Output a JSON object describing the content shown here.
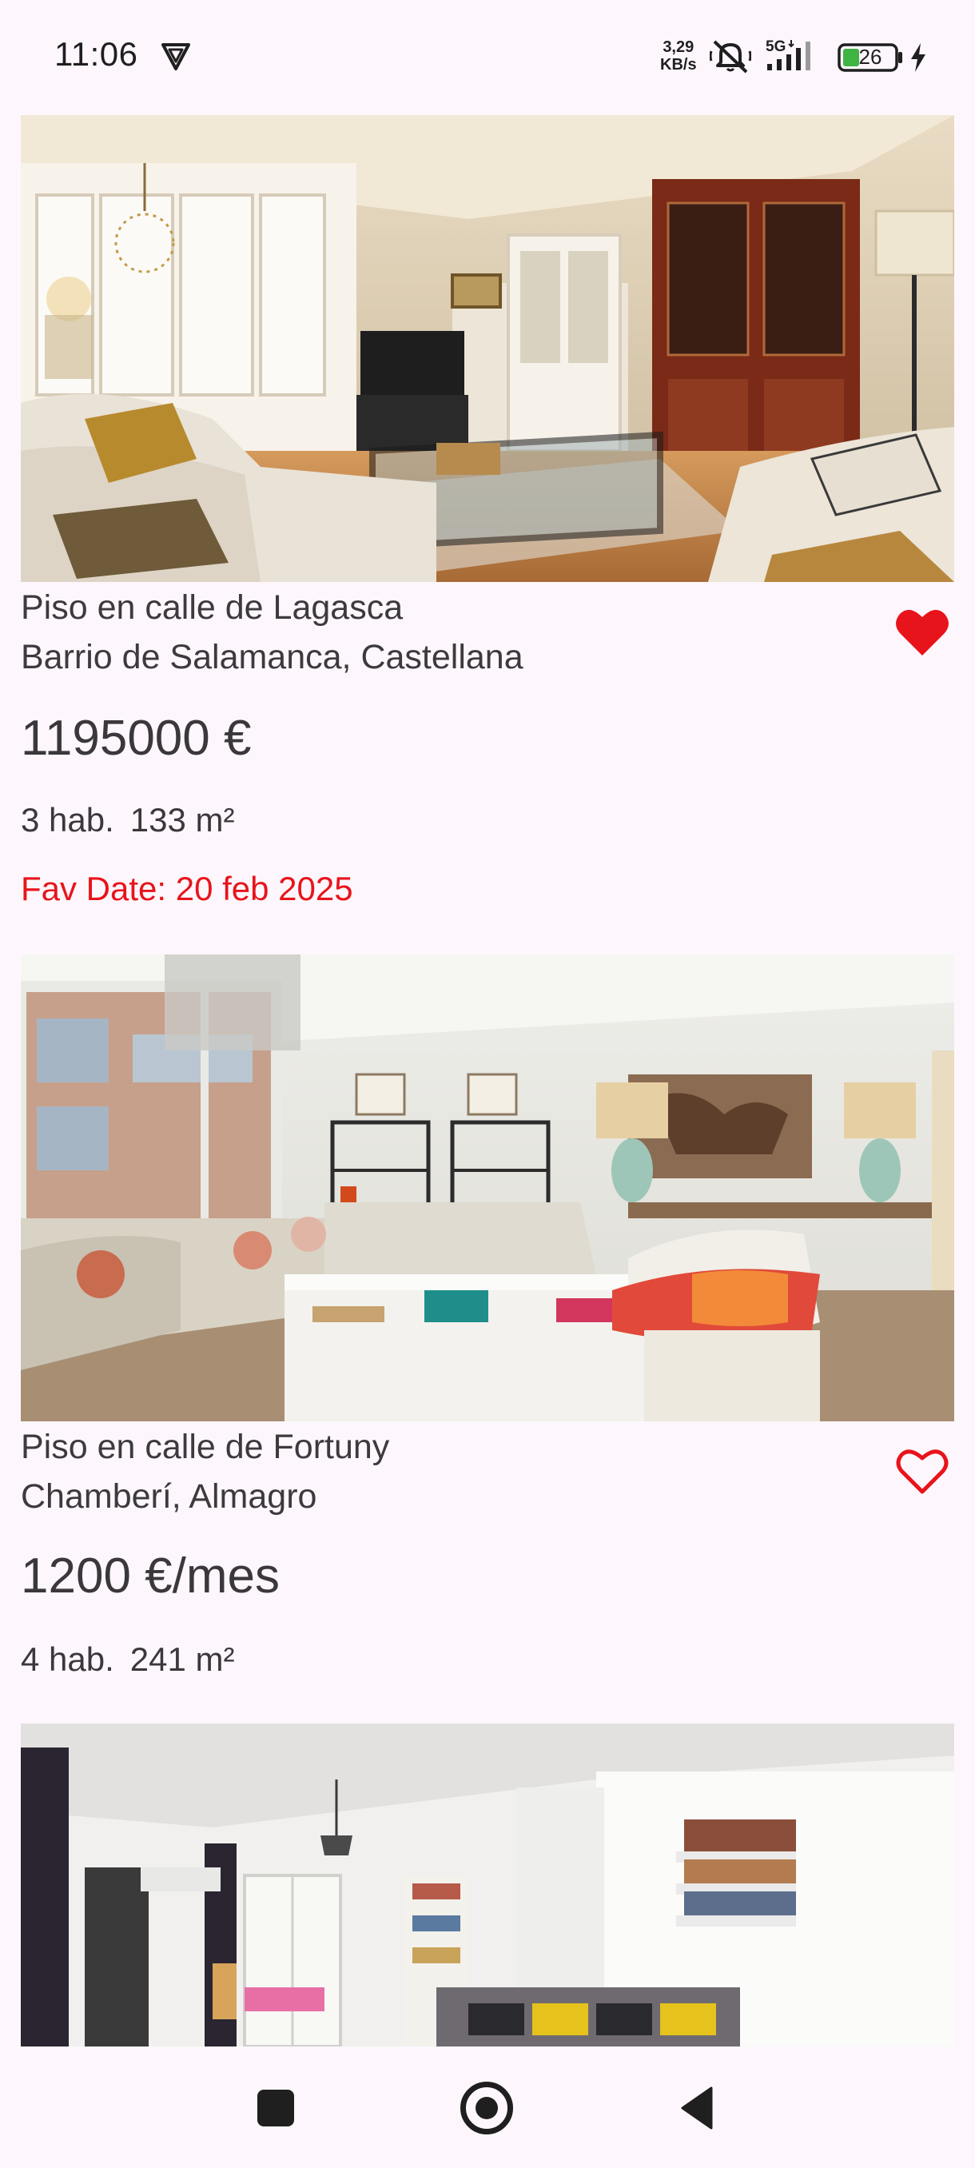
{
  "status_bar": {
    "time": "11:06",
    "net_speed_value": "3,29",
    "net_speed_unit": "KB/s",
    "network_type": "5G",
    "battery_level": "26",
    "icons": [
      "vpn-icon",
      "mute-icon",
      "signal-icon",
      "battery-icon",
      "charging-icon"
    ]
  },
  "listings": [
    {
      "title": "Piso en calle de Lagasca",
      "location": "Barrio de Salamanca, Castellana",
      "price": "1195000 €",
      "rooms": "3 hab.",
      "area": "133 m²",
      "fav_date": "Fav Date: 20 feb 2025",
      "favorite": true
    },
    {
      "title": "Piso en calle de Fortuny",
      "location": "Chamberí, Almagro",
      "price": "1200 €/mes",
      "rooms": "4 hab.",
      "area": "241 m²",
      "favorite": false
    }
  ],
  "colors": {
    "background": "#fdf7fd",
    "text": "#3b383c",
    "accent_red": "#e8141b"
  },
  "nav_bar": {
    "icons": [
      "recent-apps-icon",
      "home-icon",
      "back-icon"
    ]
  }
}
